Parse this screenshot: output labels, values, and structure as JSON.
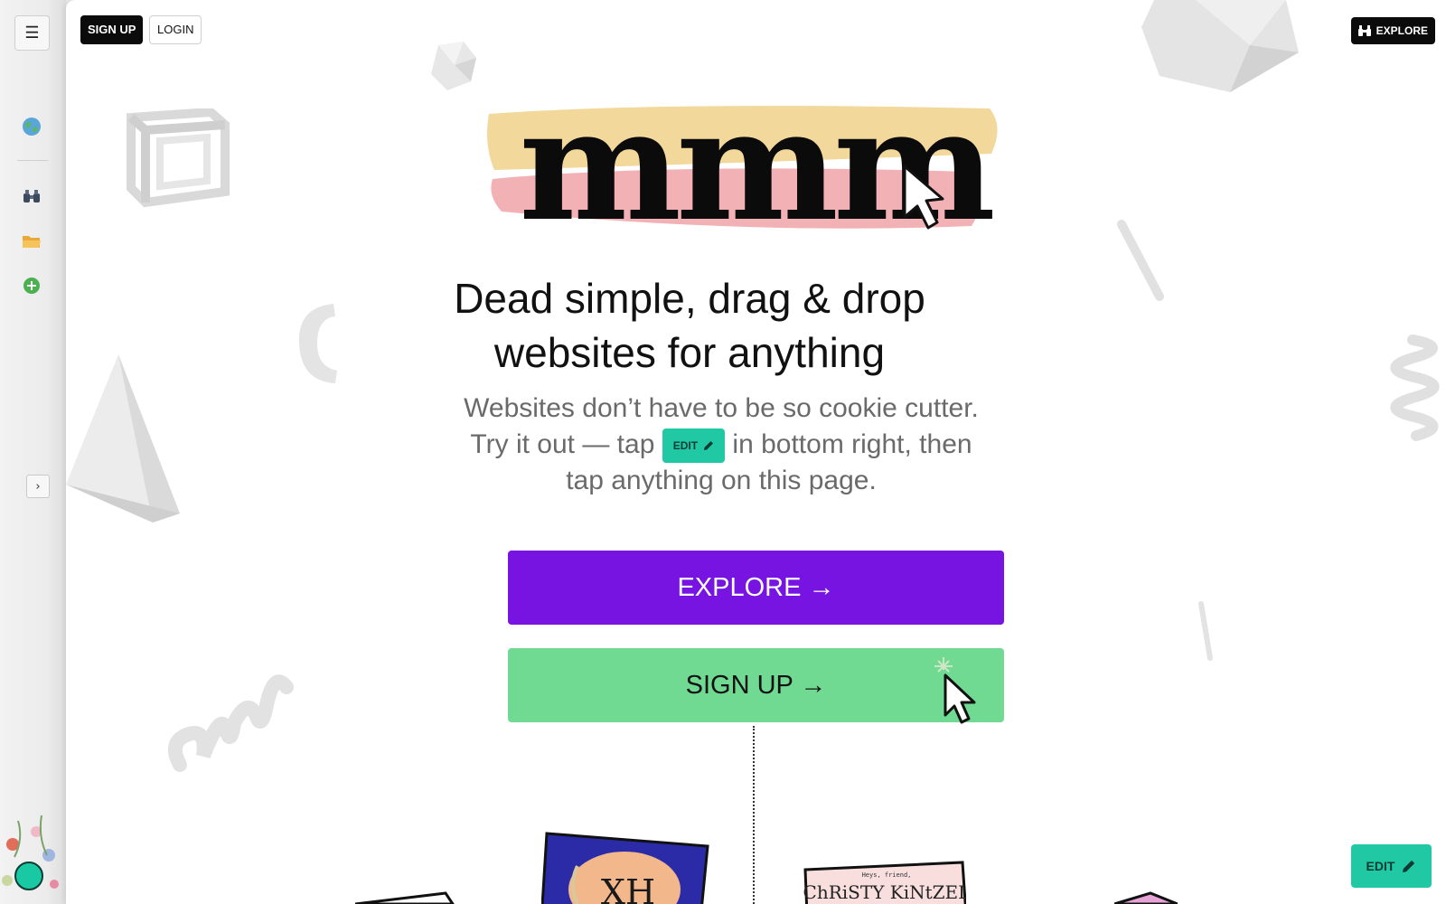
{
  "sidebar": {
    "menu_icon": "menu-icon",
    "items": [
      {
        "name": "globe-icon"
      },
      {
        "name": "binoculars-icon"
      },
      {
        "name": "folder-icon"
      },
      {
        "name": "add-icon"
      }
    ],
    "expand_glyph": "›"
  },
  "topbar": {
    "signup_label": "SIGN UP",
    "login_label": "LOGIN",
    "explore_label": "EXPLORE"
  },
  "hero": {
    "logo_text": "mmm",
    "headline": "Dead simple, drag & drop websites for anything",
    "sub_before": "Websites don’t have to be so cookie cutter. Try it out — tap",
    "inline_edit_label": "EDIT",
    "sub_after": "in bottom right, then tap anything on this page."
  },
  "cta": {
    "explore_label": "EXPLORE →",
    "signup_label": "SIGN UP →"
  },
  "cards": {
    "card1_text": "XH",
    "card2_small": "Heys, friend,",
    "card2_text": "ChRiSTY KiNtZEL"
  },
  "edit_button_label": "EDIT",
  "colors": {
    "explore_purple": "#7714e2",
    "signup_green": "#70da93",
    "edit_teal": "#20c9a4"
  }
}
